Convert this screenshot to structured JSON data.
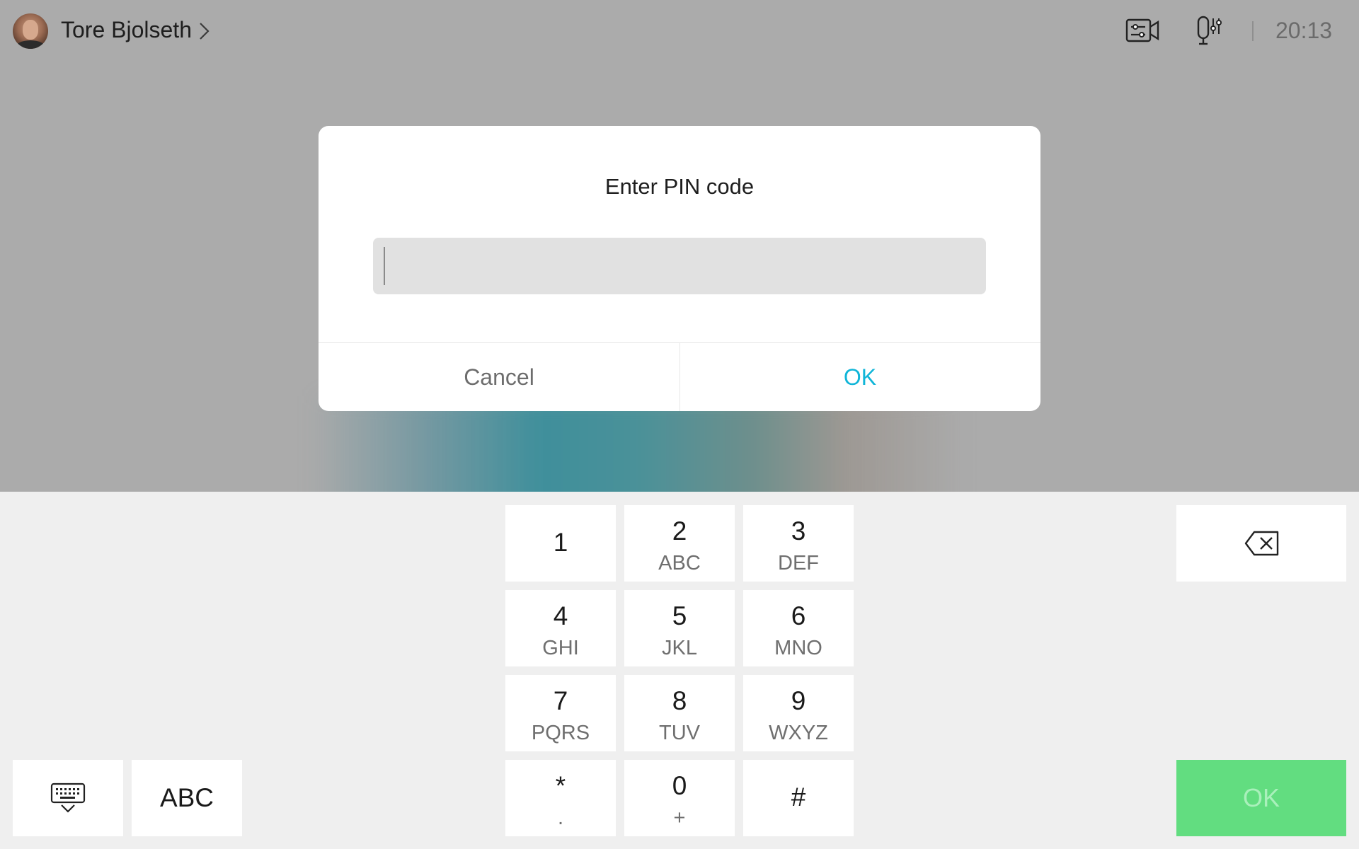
{
  "header": {
    "user_name": "Tore Bjolseth",
    "time": "20:13",
    "icons": [
      "avatar",
      "chevron-right-icon",
      "camera-settings-icon",
      "microphone-settings-icon"
    ]
  },
  "dialog": {
    "title": "Enter PIN code",
    "pin_value": "",
    "cancel_label": "Cancel",
    "ok_label": "OK"
  },
  "keypad": {
    "keys": [
      {
        "digit": "1",
        "letters": ""
      },
      {
        "digit": "2",
        "letters": "ABC"
      },
      {
        "digit": "3",
        "letters": "DEF"
      },
      {
        "digit": "4",
        "letters": "GHI"
      },
      {
        "digit": "5",
        "letters": "JKL"
      },
      {
        "digit": "6",
        "letters": "MNO"
      },
      {
        "digit": "7",
        "letters": "PQRS"
      },
      {
        "digit": "8",
        "letters": "TUV"
      },
      {
        "digit": "9",
        "letters": "WXYZ"
      },
      {
        "digit": "*",
        "letters": "."
      },
      {
        "digit": "0",
        "letters": "+"
      },
      {
        "digit": "#",
        "letters": ""
      }
    ],
    "abc_label": "ABC",
    "ok_label": "OK",
    "backspace_icon": "backspace-icon",
    "keyboard_icon": "keyboard-hide-icon"
  },
  "colors": {
    "background_top": "#ababab",
    "keypad_background": "#efefef",
    "accent_ok": "#10b5d8",
    "ok_key": "#62dd80",
    "ok_key_text": "#a9f0bb"
  }
}
